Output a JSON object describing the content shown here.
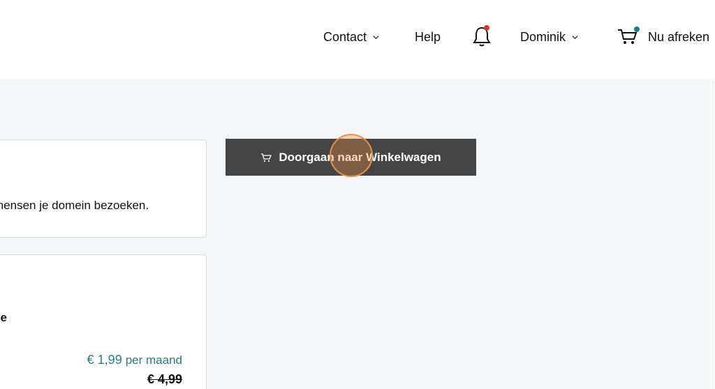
{
  "header": {
    "nav": {
      "contact_label": "Contact",
      "help_label": "Help",
      "user_label": "Dominik",
      "checkout_label": "Nu afreken"
    },
    "icons": {
      "notifications": "bell-icon",
      "cart": "cart-icon",
      "dropdown": "chevron-down-icon"
    },
    "colors": {
      "notification_dot": "#d7372b",
      "cart_dot": "#1b7b86"
    }
  },
  "main": {
    "continue_button_label": "Doorgaan naar Winkelwagen",
    "card1": {
      "text": "mensen je domein bezoeken."
    },
    "card2": {
      "heading": "se",
      "price": "€ 1,99",
      "price_suffix": "per maand",
      "old_price": "€ 4,99"
    }
  },
  "colors": {
    "button_bg": "#444444",
    "accent_price": "#2b7a83",
    "page_bg": "#f5f6f8"
  }
}
